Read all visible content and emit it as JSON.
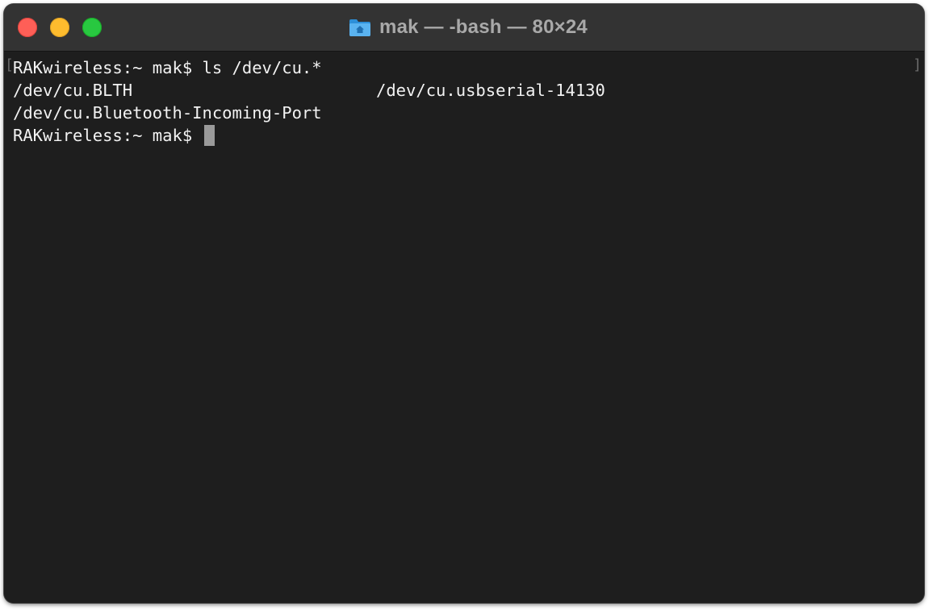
{
  "window": {
    "title": "mak — -bash — 80×24",
    "title_icon": "home-folder-icon",
    "traffic_lights": {
      "close_color": "#fe5f57",
      "minimize_color": "#febc2e",
      "zoom_color": "#28c840"
    }
  },
  "terminal": {
    "background": "#1e1e1e",
    "foreground": "#f2f2f2",
    "lines": [
      {
        "text": "RAKwireless:~ mak$ ls /dev/cu.*"
      },
      {
        "col1": "/dev/cu.BLTH",
        "col2": "/dev/cu.usbserial-14130"
      },
      {
        "text": "/dev/cu.Bluetooth-Incoming-Port"
      },
      {
        "prompt": "RAKwireless:~ mak$ "
      }
    ],
    "bracket_left": "[",
    "bracket_right": "]"
  }
}
